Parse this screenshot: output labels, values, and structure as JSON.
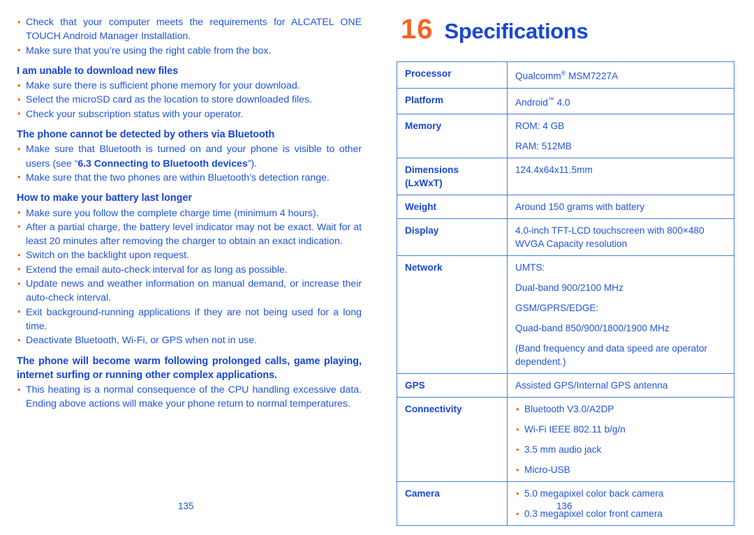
{
  "colors": {
    "body_blue": "#2255d8",
    "heading_blue": "#1747d6",
    "accent_orange": "#f26522",
    "table_border": "#4a7fd4"
  },
  "left_column": {
    "blocks": [
      {
        "type": "bullet",
        "text": "Check that your computer meets the requirements for ALCATEL ONE TOUCH Android Manager Installation."
      },
      {
        "type": "bullet",
        "text": "Make sure that you’re using the right cable from the box."
      },
      {
        "type": "heading",
        "text": "I am unable to download new files"
      },
      {
        "type": "bullet",
        "text": "Make sure there is sufficient phone memory for your download."
      },
      {
        "type": "bullet",
        "text": "Select the microSD card as the location to store downloaded files."
      },
      {
        "type": "bullet",
        "text": "Check your subscription status with your operator."
      },
      {
        "type": "heading",
        "text": "The phone cannot be detected by others via Bluetooth"
      },
      {
        "type": "bullet_rich",
        "pre": "Make sure that Bluetooth is turned on and your phone is visible to other users (see “",
        "bold": "6.3 Connecting to Bluetooth devices",
        "post": "”)."
      },
      {
        "type": "bullet",
        "text": "Make sure that the two phones are within Bluetooth’s detection range."
      },
      {
        "type": "heading",
        "text": "How to make your battery last longer"
      },
      {
        "type": "bullet",
        "text": "Make sure you follow the complete charge time (minimum 4 hours)."
      },
      {
        "type": "bullet",
        "text": "After a partial charge, the battery level indicator may not be exact. Wait for at least 20 minutes after removing the charger to obtain an exact indication."
      },
      {
        "type": "bullet",
        "text": "Switch on the backlight upon request."
      },
      {
        "type": "bullet",
        "text": "Extend the email auto-check interval for as long as possible."
      },
      {
        "type": "bullet",
        "text": "Update news and weather information on manual demand, or increase their auto-check interval."
      },
      {
        "type": "bullet",
        "text": "Exit background-running applications if they are not being used for a long time."
      },
      {
        "type": "bullet",
        "text": "Deactivate Bluetooth, Wi-Fi, or GPS when not in use."
      },
      {
        "type": "heading_just",
        "text": "The phone will become warm following prolonged calls, game playing, internet surfing or running other complex applications."
      },
      {
        "type": "bullet",
        "text": "This heating is a normal consequence of the CPU handling excessive data. Ending above actions will make your phone return to normal temperatures."
      }
    ]
  },
  "right_column": {
    "chapter_number": "16",
    "chapter_title": "Specifications",
    "spec_table": {
      "rows": [
        {
          "key": "Processor",
          "lines": [
            "Qualcomm® MSM7227A"
          ],
          "style": "plain"
        },
        {
          "key": "Platform",
          "lines": [
            "Android™ 4.0"
          ],
          "style": "plain"
        },
        {
          "key": "Memory",
          "lines": [
            "ROM: 4 GB",
            "RAM: 512MB"
          ],
          "style": "spaced"
        },
        {
          "key": "Dimensions\n(LxWxT)",
          "lines": [
            "124.4x64x11.5mm",
            ""
          ],
          "style": "plain"
        },
        {
          "key": "Weight",
          "lines": [
            "Around 150 grams with battery"
          ],
          "style": "plain"
        },
        {
          "key": "Display",
          "lines": [
            "4.0-inch TFT-LCD touchscreen with 800×480 WVGA Capacity resolution"
          ],
          "style": "plain"
        },
        {
          "key": "Network",
          "lines": [
            "UMTS:",
            "Dual-band 900/2100 MHz",
            "GSM/GPRS/EDGE:",
            "Quad-band 850/900/1800/1900 MHz",
            "(Band frequency and data speed are operator dependent.)"
          ],
          "style": "spaced"
        },
        {
          "key": "GPS",
          "lines": [
            "Assisted GPS/Internal GPS antenna"
          ],
          "style": "plain"
        },
        {
          "key": "Connectivity",
          "lines": [
            "Bluetooth V3.0/A2DP",
            "Wi-Fi IEEE 802.11 b/g/n",
            "3.5 mm audio jack",
            "Micro-USB"
          ],
          "style": "bullets"
        },
        {
          "key": "Camera",
          "lines": [
            "5.0 megapixel color back camera",
            "0.3 megapixel color front camera"
          ],
          "style": "bullets"
        }
      ]
    }
  },
  "page_numbers": {
    "left": "135",
    "right": "136"
  }
}
